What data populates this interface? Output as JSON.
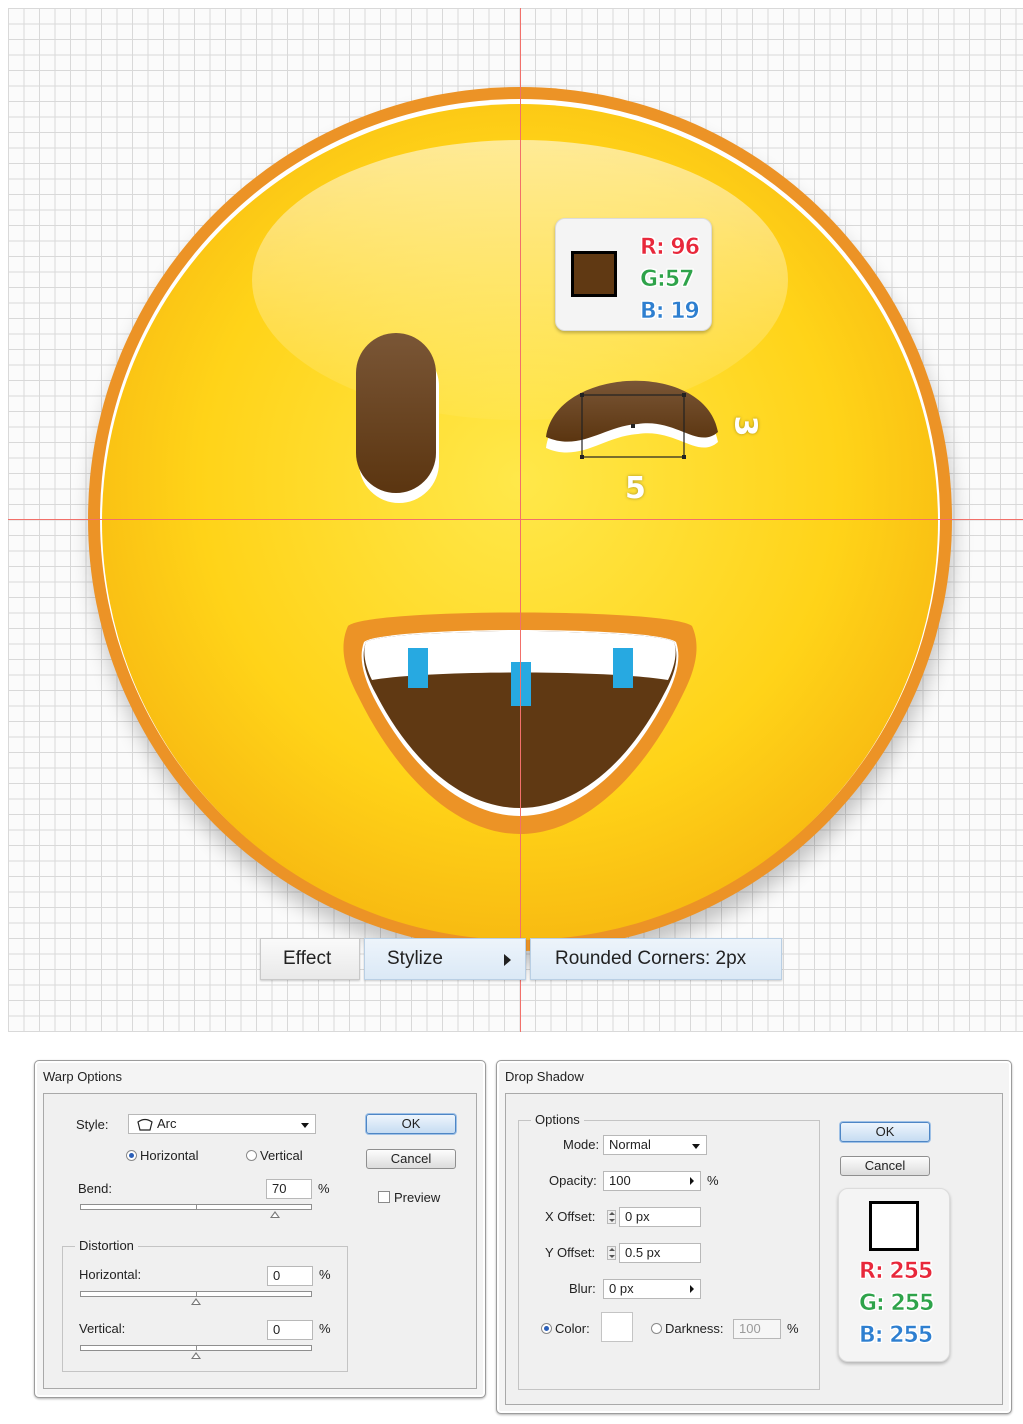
{
  "emoji_callouts": {
    "eye_fill_color": {
      "hex": "#603913",
      "r_label": "R: 96",
      "g_label": "G:57",
      "b_label": "B: 19"
    },
    "dim_height": "3",
    "dim_width": "5"
  },
  "colors": {
    "guide": "#f2706a",
    "face_outline": "#ec9326",
    "face_yellow": "#ffd21a",
    "feature_brown": "#603913",
    "tooth_gap_blue": "#27a9e1"
  },
  "menu": {
    "effect": "Effect",
    "stylize": "Stylize",
    "rounded_corners": "Rounded Corners: 2px"
  },
  "warp_options": {
    "title": "Warp Options",
    "style_label": "Style:",
    "style_value": "Arc",
    "style_icon": "arc-warp-icon",
    "orientation_horizontal": "Horizontal",
    "orientation_vertical": "Vertical",
    "orientation_selected": "Horizontal",
    "bend_label": "Bend:",
    "bend_value": "70",
    "bend_unit": "%",
    "ok": "OK",
    "cancel": "Cancel",
    "preview": "Preview",
    "preview_checked": false,
    "distortion_label": "Distortion",
    "horizontal_label": "Horizontal:",
    "horizontal_value": "0",
    "horizontal_unit": "%",
    "vertical_label": "Vertical:",
    "vertical_value": "0",
    "vertical_unit": "%"
  },
  "drop_shadow": {
    "title": "Drop Shadow",
    "options_label": "Options",
    "mode_label": "Mode:",
    "mode_value": "Normal",
    "opacity_label": "Opacity:",
    "opacity_value": "100",
    "opacity_unit": "%",
    "x_offset_label": "X Offset:",
    "x_offset_value": "0 px",
    "y_offset_label": "Y Offset:",
    "y_offset_value": "0.5 px",
    "blur_label": "Blur:",
    "blur_value": "0 px",
    "color_label": "Color:",
    "darkness_label": "Darkness:",
    "darkness_value": "100",
    "darkness_unit": "%",
    "ok": "OK",
    "cancel": "Cancel",
    "shadow_color": {
      "hex": "#ffffff",
      "r_label": "R: 255",
      "g_label": "G: 255",
      "b_label": "B: 255"
    }
  }
}
